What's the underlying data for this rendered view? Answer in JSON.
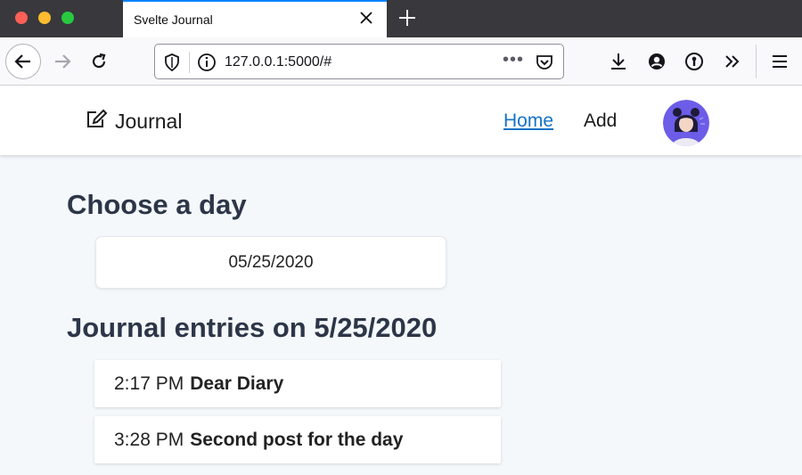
{
  "browser": {
    "tab_title": "Svelte Journal",
    "url": "127.0.0.1:5000/#",
    "url_actions": "•••"
  },
  "app": {
    "brand": "Journal",
    "nav": {
      "home": "Home",
      "add": "Add"
    }
  },
  "main": {
    "choose_heading": "Choose a day",
    "selected_date": "05/25/2020",
    "entries_heading": "Journal entries on 5/25/2020",
    "entries": [
      {
        "time": "2:17 PM",
        "title": "Dear Diary"
      },
      {
        "time": "3:28 PM",
        "title": "Second post for the day"
      }
    ]
  },
  "colors": {
    "accent_link": "#1473c5",
    "heading": "#2d3648",
    "page_bg": "#f4f8fb",
    "avatar_bg": "#6c5ce7"
  },
  "icons": [
    "close-icon",
    "plus-icon",
    "back-arrow-icon",
    "forward-arrow-icon",
    "reload-icon",
    "shield-icon",
    "info-icon",
    "pocket-icon",
    "download-icon",
    "account-icon",
    "password-icon",
    "chevrons-icon",
    "hamburger-menu-icon",
    "edit-icon"
  ]
}
